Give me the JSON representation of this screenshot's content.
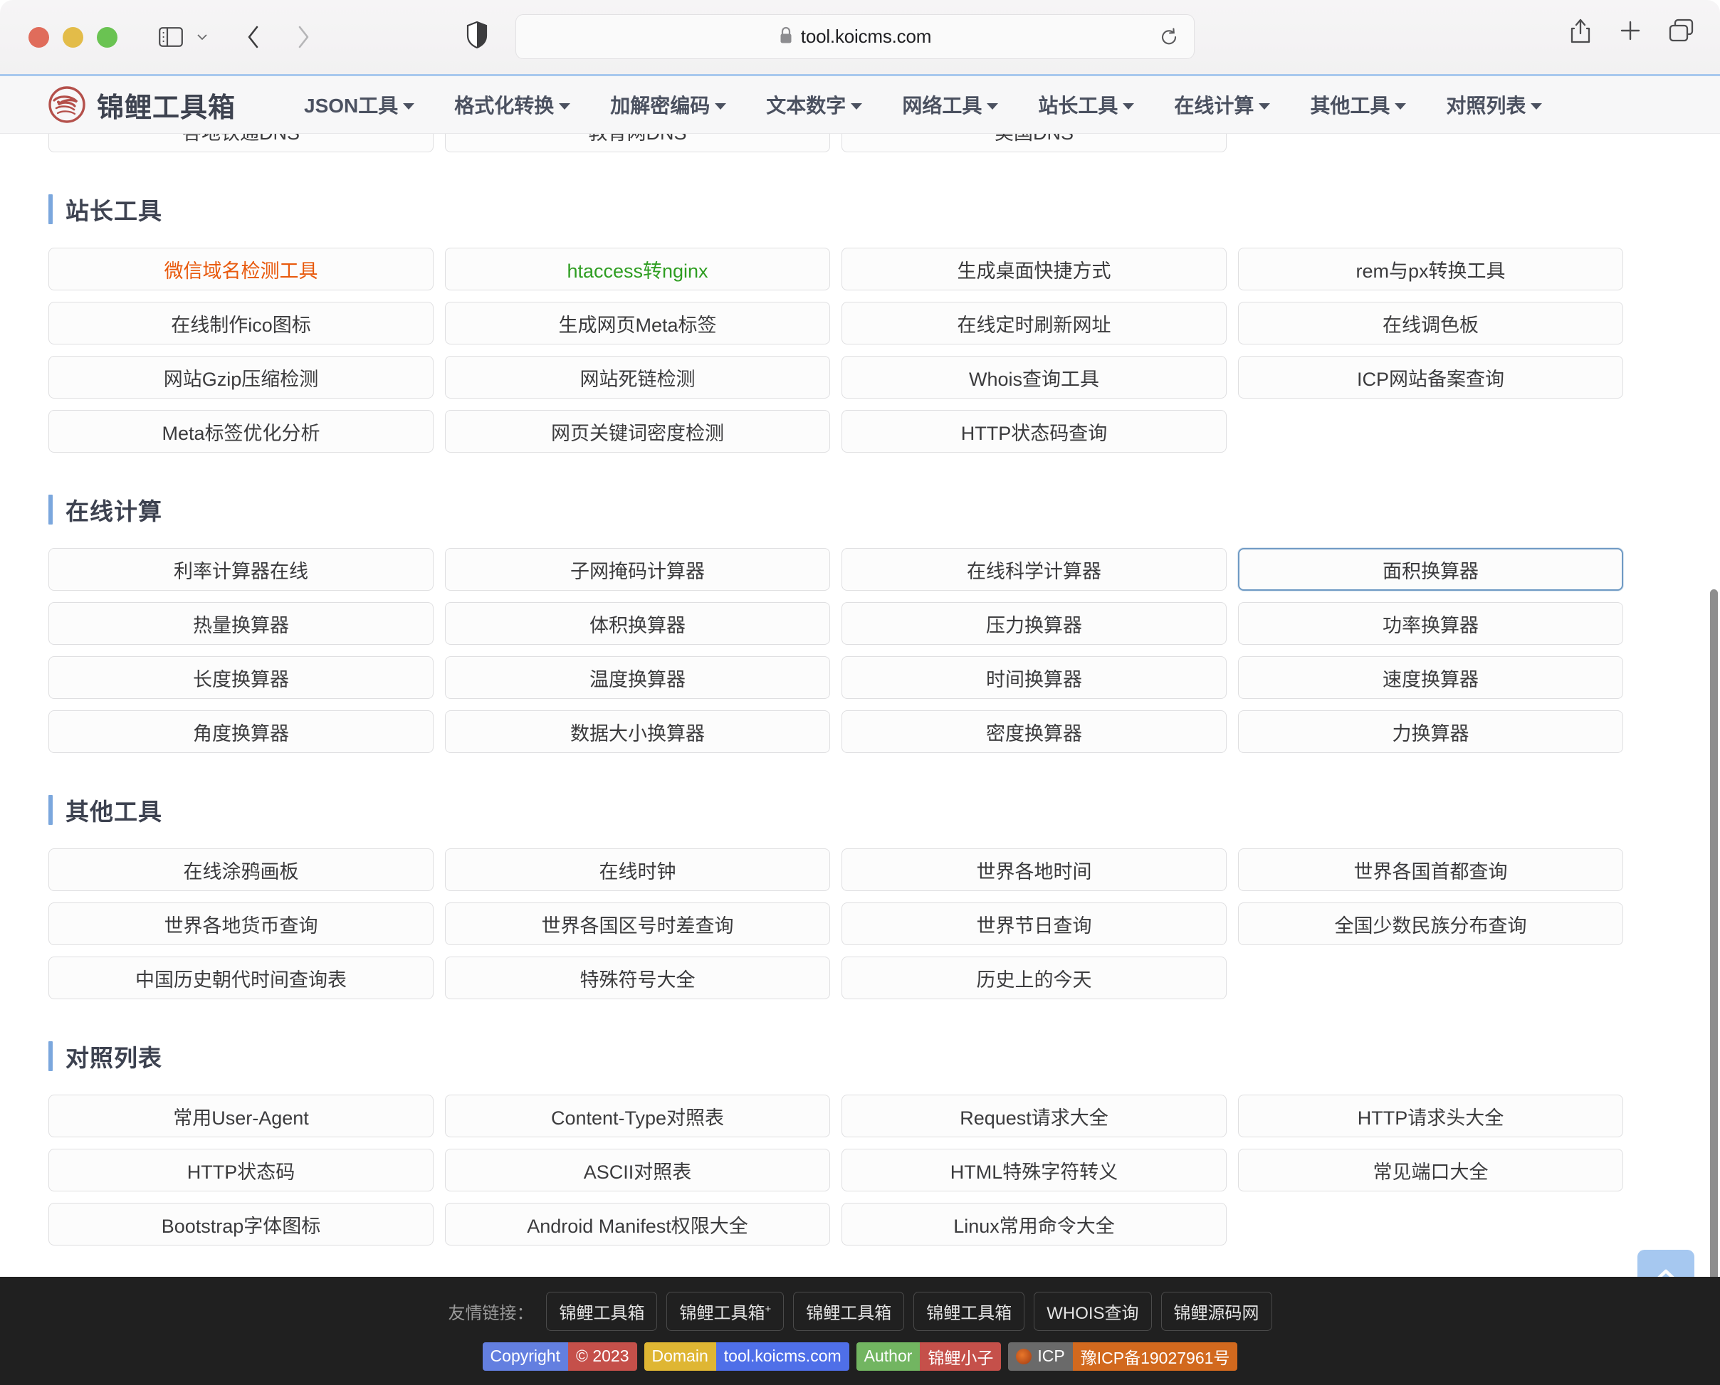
{
  "browser": {
    "url": "tool.koicms.com",
    "lock_icon": "lock-icon",
    "sidebar_icon": "sidebar-toggle-icon",
    "back_icon": "chevron-left-icon",
    "forward_icon": "chevron-right-icon",
    "shield_icon": "privacy-shield-icon",
    "reload_icon": "reload-icon",
    "share_icon": "share-icon",
    "newtab_icon": "plus-icon",
    "tabs_icon": "tab-overview-icon"
  },
  "site": {
    "brand": "锦鲤工具箱",
    "logo_icon": "koi-fish-logo-icon",
    "nav": [
      {
        "label": "JSON工具"
      },
      {
        "label": "格式化转换"
      },
      {
        "label": "加解密编码"
      },
      {
        "label": "文本数字"
      },
      {
        "label": "网络工具"
      },
      {
        "label": "站长工具"
      },
      {
        "label": "在线计算"
      },
      {
        "label": "其他工具"
      },
      {
        "label": "对照列表"
      }
    ]
  },
  "clipped_row": {
    "items": [
      "各地铁通DNS",
      "教育网DNS",
      "美国DNS",
      ""
    ]
  },
  "sections": [
    {
      "title": "站长工具",
      "items": [
        {
          "label": "微信域名检测工具",
          "style": "orange"
        },
        {
          "label": "htaccess转nginx",
          "style": "green"
        },
        {
          "label": "生成桌面快捷方式",
          "style": ""
        },
        {
          "label": "rem与px转换工具",
          "style": ""
        },
        {
          "label": "在线制作ico图标",
          "style": ""
        },
        {
          "label": "生成网页Meta标签",
          "style": ""
        },
        {
          "label": "在线定时刷新网址",
          "style": ""
        },
        {
          "label": "在线调色板",
          "style": ""
        },
        {
          "label": "网站Gzip压缩检测",
          "style": ""
        },
        {
          "label": "网站死链检测",
          "style": ""
        },
        {
          "label": "Whois查询工具",
          "style": ""
        },
        {
          "label": "ICP网站备案查询",
          "style": ""
        },
        {
          "label": "Meta标签优化分析",
          "style": ""
        },
        {
          "label": "网页关键词密度检测",
          "style": ""
        },
        {
          "label": "HTTP状态码查询",
          "style": ""
        }
      ]
    },
    {
      "title": "在线计算",
      "items": [
        {
          "label": "利率计算器在线",
          "style": ""
        },
        {
          "label": "子网掩码计算器",
          "style": ""
        },
        {
          "label": "在线科学计算器",
          "style": ""
        },
        {
          "label": "面积换算器",
          "style": "focused"
        },
        {
          "label": "热量换算器",
          "style": ""
        },
        {
          "label": "体积换算器",
          "style": ""
        },
        {
          "label": "压力换算器",
          "style": ""
        },
        {
          "label": "功率换算器",
          "style": ""
        },
        {
          "label": "长度换算器",
          "style": ""
        },
        {
          "label": "温度换算器",
          "style": ""
        },
        {
          "label": "时间换算器",
          "style": ""
        },
        {
          "label": "速度换算器",
          "style": ""
        },
        {
          "label": "角度换算器",
          "style": ""
        },
        {
          "label": "数据大小换算器",
          "style": ""
        },
        {
          "label": "密度换算器",
          "style": ""
        },
        {
          "label": "力换算器",
          "style": ""
        }
      ]
    },
    {
      "title": "其他工具",
      "items": [
        {
          "label": "在线涂鸦画板",
          "style": ""
        },
        {
          "label": "在线时钟",
          "style": ""
        },
        {
          "label": "世界各地时间",
          "style": ""
        },
        {
          "label": "世界各国首都查询",
          "style": ""
        },
        {
          "label": "世界各地货币查询",
          "style": ""
        },
        {
          "label": "世界各国区号时差查询",
          "style": ""
        },
        {
          "label": "世界节日查询",
          "style": ""
        },
        {
          "label": "全国少数民族分布查询",
          "style": ""
        },
        {
          "label": "中国历史朝代时间查询表",
          "style": ""
        },
        {
          "label": "特殊符号大全",
          "style": ""
        },
        {
          "label": "历史上的今天",
          "style": ""
        }
      ]
    },
    {
      "title": "对照列表",
      "items": [
        {
          "label": "常用User-Agent",
          "style": ""
        },
        {
          "label": "Content-Type对照表",
          "style": ""
        },
        {
          "label": "Request请求大全",
          "style": ""
        },
        {
          "label": "HTTP请求头大全",
          "style": ""
        },
        {
          "label": "HTTP状态码",
          "style": ""
        },
        {
          "label": "ASCII对照表",
          "style": ""
        },
        {
          "label": "HTML特殊字符转义",
          "style": ""
        },
        {
          "label": "常见端口大全",
          "style": ""
        },
        {
          "label": "Bootstrap字体图标",
          "style": ""
        },
        {
          "label": "Android Manifest权限大全",
          "style": ""
        },
        {
          "label": "Linux常用命令大全",
          "style": ""
        }
      ]
    }
  ],
  "footer": {
    "friend_label": "友情链接：",
    "friend_links": [
      {
        "text": "锦鲤工具箱",
        "sup": ""
      },
      {
        "text": "锦鲤工具箱",
        "sup": "+"
      },
      {
        "text": "锦鲤工具箱",
        "sup": ""
      },
      {
        "text": "锦鲤工具箱",
        "sup": ""
      },
      {
        "text": "WHOIS查询",
        "sup": ""
      },
      {
        "text": "锦鲤源码网",
        "sup": ""
      }
    ],
    "badges": [
      {
        "left": "Copyright",
        "right": "© 2023",
        "left_class": "b-left-blue",
        "right_class": "b-right-red"
      },
      {
        "left": "Domain",
        "right": "tool.koicms.com",
        "left_class": "b-left-yellow",
        "right_class": "b-right-blue"
      },
      {
        "left": "Author",
        "right": "锦鲤小子",
        "left_class": "b-left-green",
        "right_class": "b-right-red2"
      },
      {
        "left": "ICP",
        "right": "豫ICP备19027961号",
        "left_class": "b-left-gray",
        "right_class": "b-right-orange",
        "icon": "icp-seal-icon"
      }
    ]
  },
  "back_to_top": {
    "icon": "chevron-up-icon"
  },
  "colors": {
    "accent_blue": "#7ba7dd",
    "orange_link": "#e8590c",
    "green_link": "#2f9e22",
    "footer_bg": "#202020",
    "focus_border": "#6f9ac4",
    "back_to_top_bg": "#a6c8f0"
  }
}
